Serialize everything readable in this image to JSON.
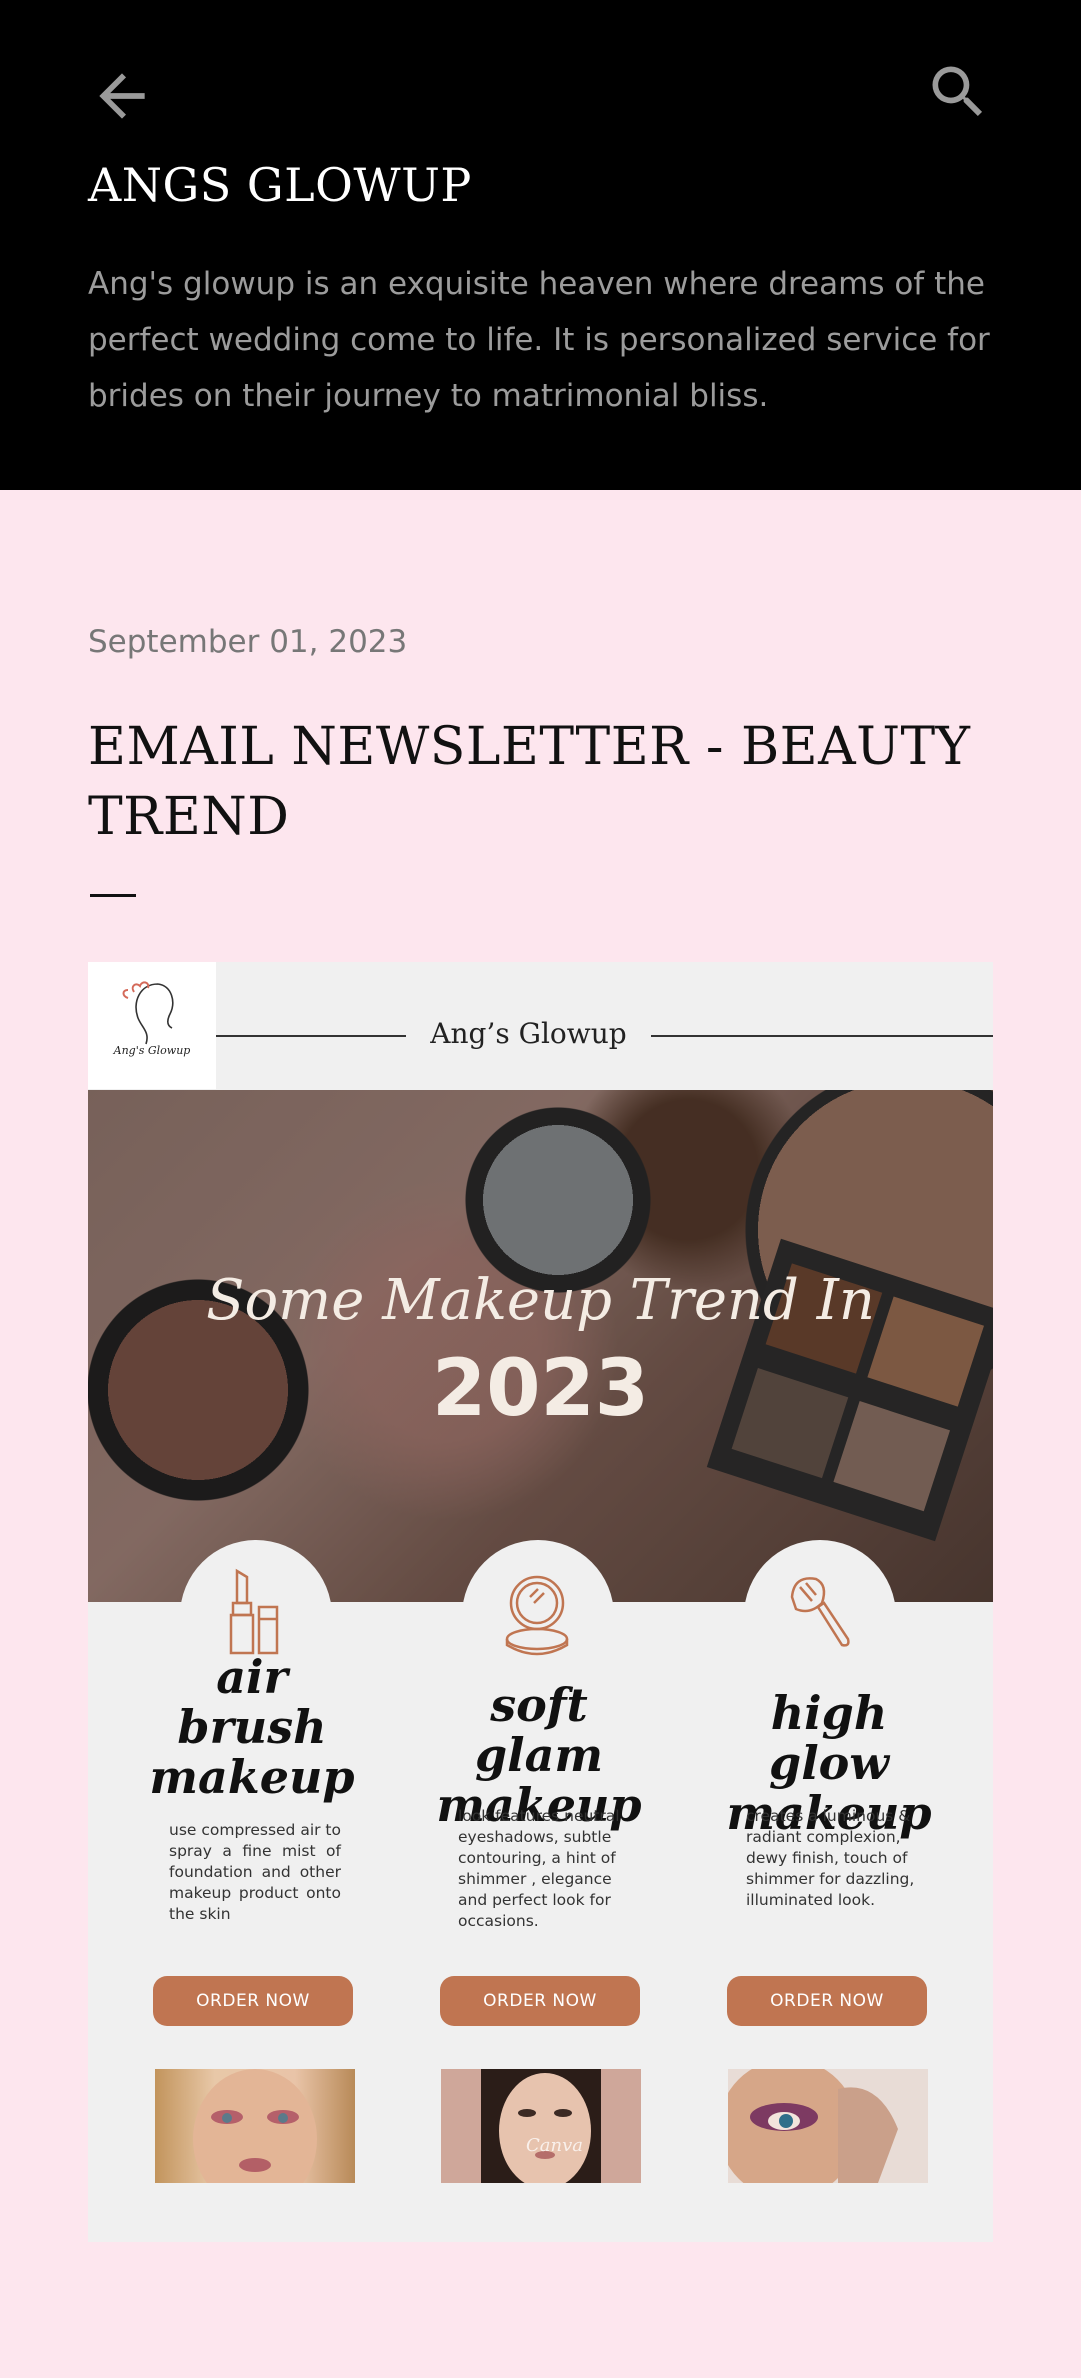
{
  "header": {
    "blog_title": "ANGS GLOWUP",
    "description": "Ang's glowup is an exquisite heaven where dreams of the perfect wedding come to life. It is personalized service for brides on their journey to matrimonial bliss.",
    "icons": {
      "back": "arrow-back-icon",
      "search": "search-icon"
    }
  },
  "post": {
    "date": "September 01, 2023",
    "title": "EMAIL NEWSLETTER - BEAUTY TREND"
  },
  "newsletter": {
    "logo_text": "Ang's Glowup",
    "brand": "Ang’s Glowup",
    "hero_line1": "Some Makeup Trend In",
    "hero_line2": "2023",
    "services": [
      {
        "icon": "lipstick-icon",
        "title": "air brush makeup",
        "description": "use compressed air to spray a fine mist of foundation and other makeup product onto the skin",
        "button": "ORDER NOW"
      },
      {
        "icon": "compact-mirror-icon",
        "title": "soft glam makeup",
        "description": "look features neutral eyeshadows, subtle contouring, a hint of shimmer , elegance and perfect look for occasions.",
        "button": "ORDER NOW"
      },
      {
        "icon": "makeup-brush-icon",
        "title": "high glow makeup",
        "description": "creates a luminous & radiant complexion, dewy finish, touch of shimmer for dazzling, illuminated look.",
        "button": "ORDER NOW"
      }
    ],
    "photo_watermark": "Canva"
  },
  "colors": {
    "page_background": "#fde6ee",
    "header_background": "#000000",
    "accent": "#c07551",
    "newsletter_background": "#f0f0f0"
  }
}
